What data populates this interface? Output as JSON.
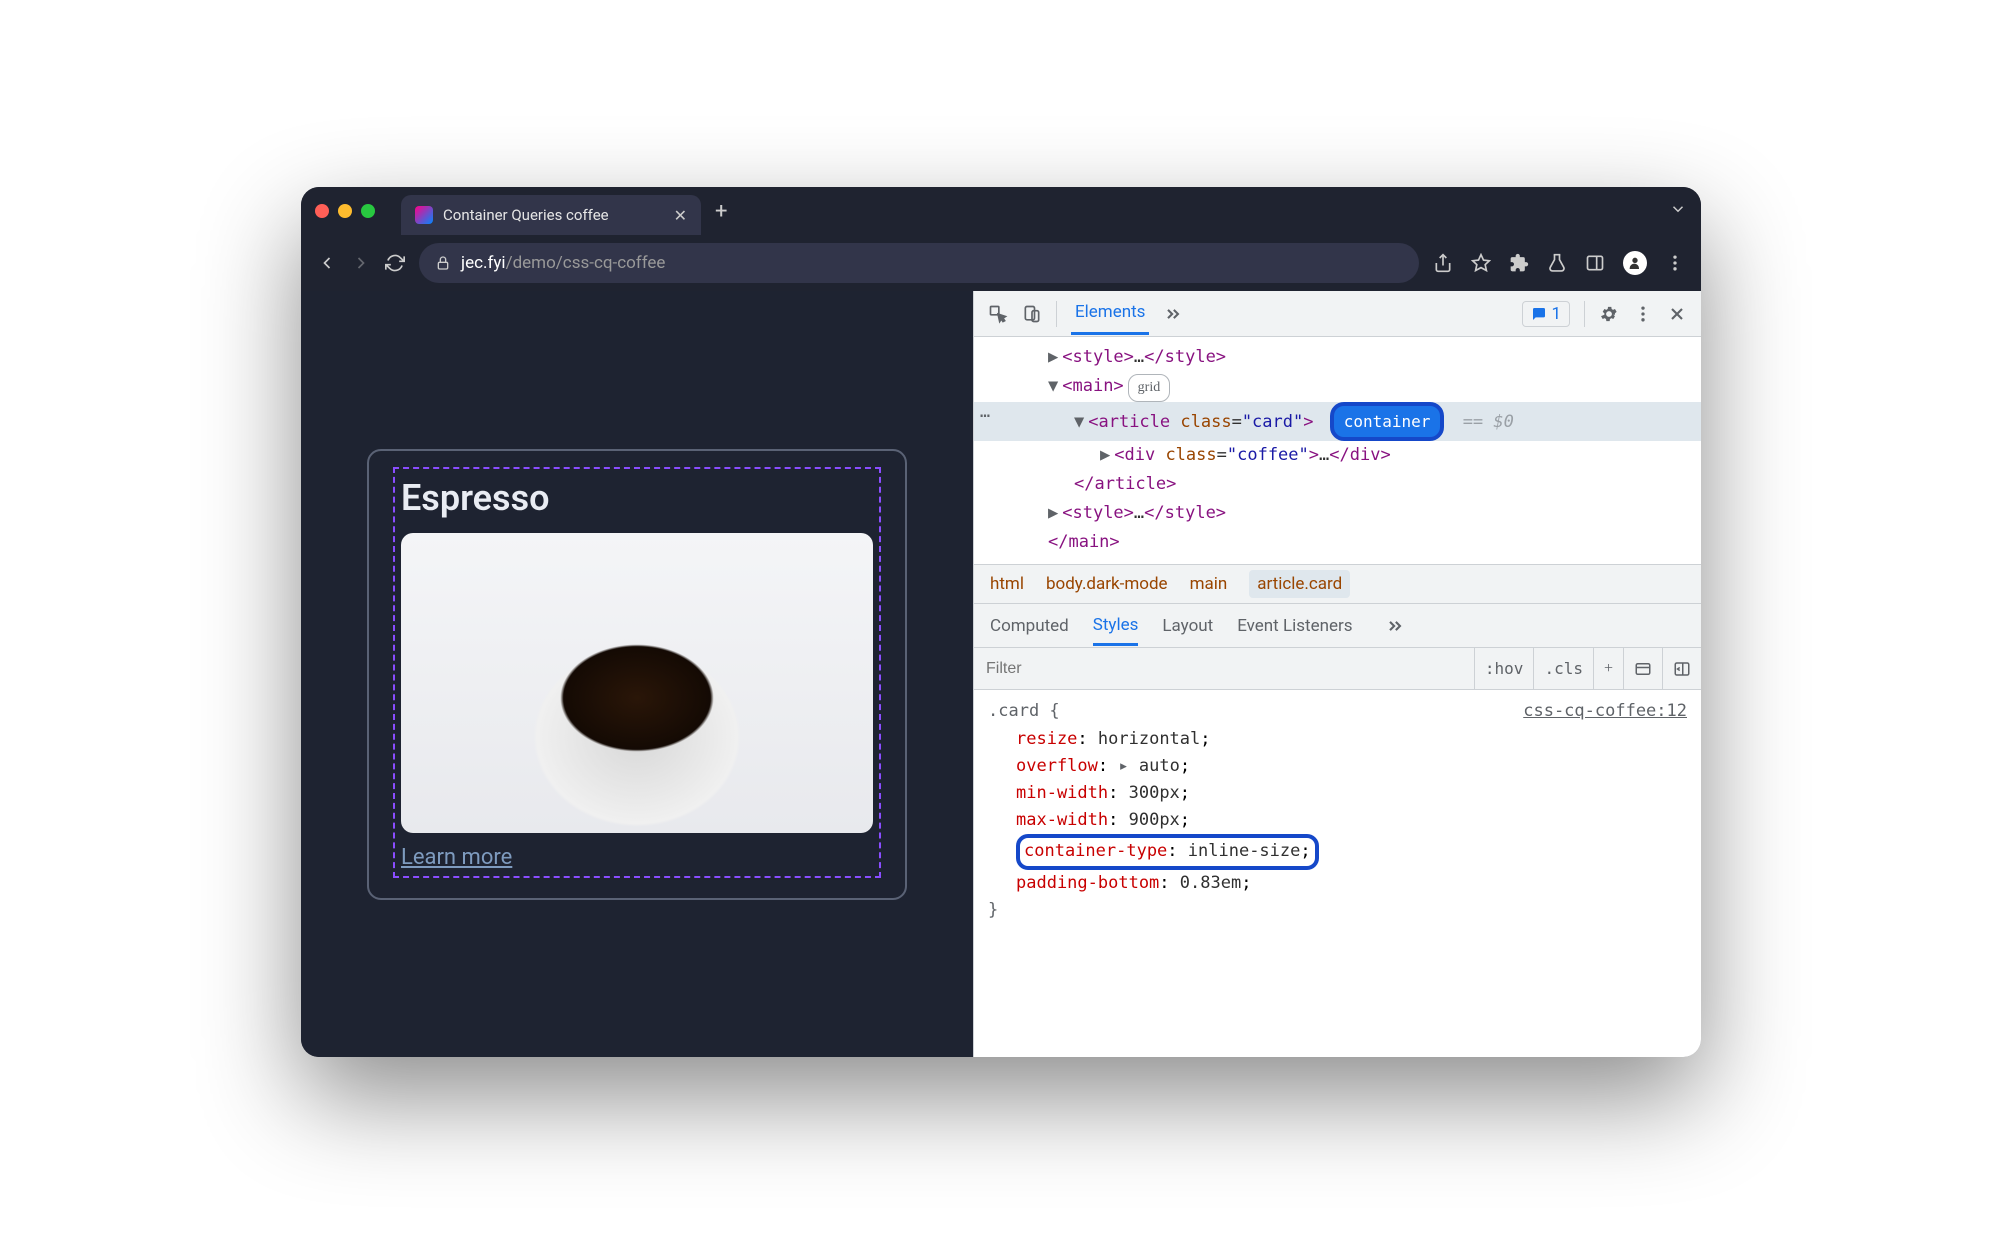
{
  "window": {
    "tab_title": "Container Queries coffee",
    "url_domain": "jec.fyi",
    "url_path": "/demo/css-cq-coffee"
  },
  "page": {
    "card_title": "Espresso",
    "learn_more": "Learn more"
  },
  "devtools": {
    "panels": {
      "elements": "Elements"
    },
    "issues_count": "1",
    "dom": {
      "style_open": "<style>",
      "style_ell": "…",
      "style_close": "</style>",
      "main_open": "<main>",
      "main_close": "</main>",
      "grid_badge": "grid",
      "article_open_1": "<article ",
      "article_attr": "class",
      "article_val": "\"card\"",
      "article_open_2": ">",
      "container_badge": "container",
      "eq_var": "== $0",
      "div_open_1": "<div ",
      "div_attr": "class",
      "div_val": "\"coffee\"",
      "div_open_2": ">",
      "div_ell": "…",
      "div_close": "</div>",
      "article_close": "</article>"
    },
    "crumbs": {
      "html": "html",
      "body": "body.dark-mode",
      "main": "main",
      "article": "article.card"
    },
    "subtabs": {
      "computed": "Computed",
      "styles": "Styles",
      "layout": "Layout",
      "event": "Event Listeners"
    },
    "filter_placeholder": "Filter",
    "hov": ":hov",
    "cls": ".cls",
    "rule": {
      "selector": ".card {",
      "src": "css-cq-coffee:12",
      "resize_p": "resize",
      "resize_v": "horizontal",
      "overflow_p": "overflow",
      "overflow_v": "auto",
      "minw_p": "min-width",
      "minw_v": "300px",
      "maxw_p": "max-width",
      "maxw_v": "900px",
      "ctype_p": "container-type",
      "ctype_v": "inline-size",
      "pb_p": "padding-bottom",
      "pb_v": "0.83em",
      "close": "}"
    }
  }
}
